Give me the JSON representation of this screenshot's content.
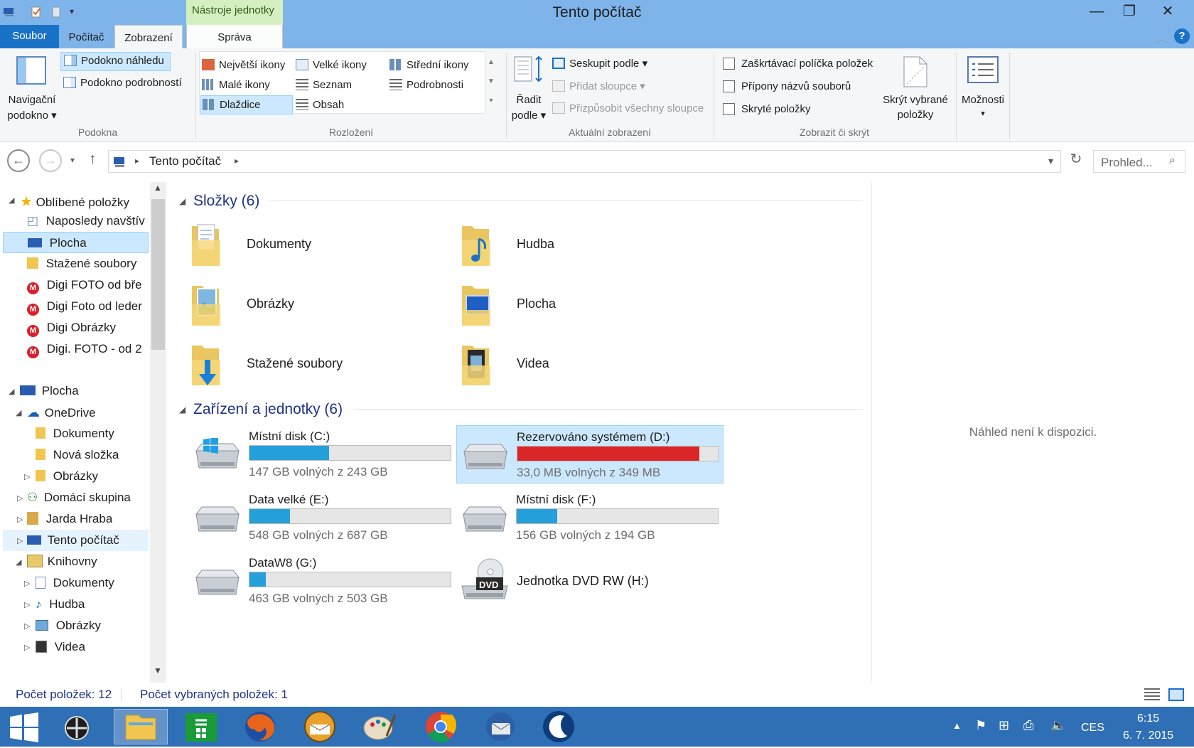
{
  "window": {
    "title": "Tento počítač",
    "context_tab_label": "Nástroje jednotky"
  },
  "tabs": {
    "soubor": "Soubor",
    "pocitac": "Počítač",
    "zobrazeni": "Zobrazení",
    "sprava": "Správa"
  },
  "ribbon": {
    "podokna": {
      "label": "Podokna",
      "nav_pane_line1": "Navigační",
      "nav_pane_line2": "podokno",
      "preview_pane": "Podokno náhledu",
      "details_pane": "Podokno podrobností"
    },
    "rozlozeni": {
      "label": "Rozložení",
      "items": [
        "Největší ikony",
        "Velké ikony",
        "Střední ikony",
        "Malé ikony",
        "Seznam",
        "Podrobnosti",
        "Dlaždice",
        "Obsah"
      ],
      "selected": "Dlaždice"
    },
    "aktualni": {
      "label": "Aktuální zobrazení",
      "sort_line1": "Řadit",
      "sort_line2": "podle",
      "group_by": "Seskupit podle",
      "add_columns": "Přidat sloupce",
      "fit_columns": "Přizpůsobit všechny sloupce"
    },
    "zobrazit": {
      "label": "Zobrazit či skrýt",
      "checkboxes": [
        "Zaškrtávací políčka položek",
        "Přípony názvů souborů",
        "Skryté položky"
      ],
      "hide_selected_line1": "Skrýt vybrané",
      "hide_selected_line2": "položky"
    },
    "options": "Možnosti"
  },
  "address": {
    "crumb": "Tento počítač",
    "search_placeholder": "Prohled..."
  },
  "nav": {
    "favorites": "Oblíbené položky",
    "fav_items": [
      "Naposledy navštív",
      "Plocha",
      "Stažené soubory",
      "Digi FOTO od bře",
      "Digi Foto od leder",
      "Digi Obrázky",
      "Digi. FOTO - od 2"
    ],
    "desktop": "Plocha",
    "onedrive": "OneDrive",
    "onedrive_items": [
      "Dokumenty",
      "Nová složka",
      "Obrázky"
    ],
    "homegroup": "Domácí skupina",
    "user": "Jarda Hraba",
    "this_pc": "Tento počítač",
    "libraries": "Knihovny",
    "lib_items": [
      "Dokumenty",
      "Hudba",
      "Obrázky",
      "Videa"
    ]
  },
  "content": {
    "folders_header": "Složky (6)",
    "folders": [
      "Dokumenty",
      "Hudba",
      "Obrázky",
      "Plocha",
      "Stažené soubory",
      "Videa"
    ],
    "devices_header": "Zařízení a jednotky (6)",
    "drives": [
      {
        "name": "Místní disk (C:)",
        "free": "147 GB volných z 243 GB",
        "used_fraction": 0.395,
        "color": "#26a0da"
      },
      {
        "name": "Rezervováno systémem (D:)",
        "free": "33,0 MB volných z 349 MB",
        "used_fraction": 0.905,
        "color": "#da2626"
      },
      {
        "name": "Data velké (E:)",
        "free": "548 GB volných z 687 GB",
        "used_fraction": 0.2,
        "color": "#26a0da"
      },
      {
        "name": "Místní disk (F:)",
        "free": "156 GB volných z 194 GB",
        "used_fraction": 0.2,
        "color": "#26a0da"
      },
      {
        "name": "DataW8 (G:)",
        "free": "463 GB volných z 503 GB",
        "used_fraction": 0.08,
        "color": "#26a0da"
      }
    ],
    "dvd": {
      "name": "Jednotka DVD RW (H:)",
      "badge": "DVD"
    }
  },
  "preview": {
    "text": "Náhled není k dispozici."
  },
  "status": {
    "count": "Počet položek: 12",
    "selected": "Počet vybraných položek: 1"
  },
  "tray": {
    "lang": "CES",
    "time": "6:15",
    "date": "6. 7. 2015"
  }
}
